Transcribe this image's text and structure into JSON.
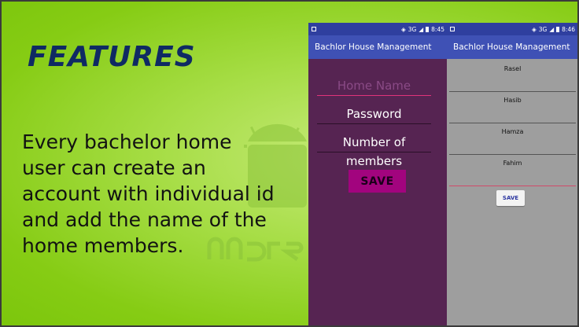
{
  "slide": {
    "title": "FEATURES",
    "body_lines": [
      "Every bachelor home",
      "user can create an",
      "account with individual id",
      "and add the name of the",
      "home members."
    ]
  },
  "phone1": {
    "status_time": "8:45",
    "status_network": "3G",
    "app_title": "Bachlor House Management",
    "name_placeholder": "Home Name",
    "password_placeholder": "Password",
    "members_placeholder": "Number of members",
    "save_label": "SAVE"
  },
  "phone2": {
    "status_time": "8:46",
    "status_network": "3G",
    "app_title": "Bachlor House Management",
    "members": [
      "Rasel",
      "Hasib",
      "Hamza",
      "Fahim"
    ],
    "save_label": "SAVE"
  },
  "colors": {
    "title": "#0f2a63",
    "status_bar": "#2f3f9f",
    "app_bar": "#3f51b5",
    "form_background": "#562452",
    "save_button": "#a2047e",
    "list_background": "#9e9e9e",
    "input_underline_active": "#e0337a"
  }
}
